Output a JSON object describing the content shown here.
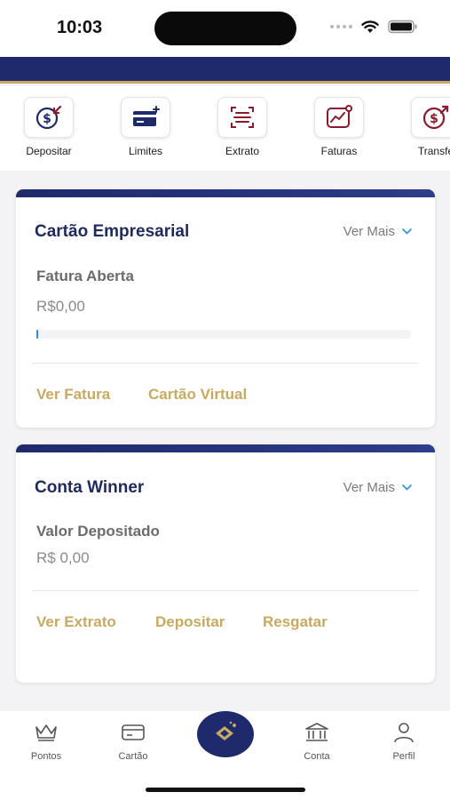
{
  "status_bar": {
    "time": "10:03"
  },
  "shortcuts": [
    {
      "label": "Depositar",
      "icon": "deposit-dollar-icon"
    },
    {
      "label": "Limites",
      "icon": "credit-card-icon"
    },
    {
      "label": "Extrato",
      "icon": "statement-scan-icon"
    },
    {
      "label": "Faturas",
      "icon": "invoice-chart-icon"
    },
    {
      "label": "Transfe",
      "icon": "transfer-dollar-icon"
    }
  ],
  "card_empresarial": {
    "title": "Cartão Empresarial",
    "ver_mais": "Ver Mais",
    "subtitle": "Fatura Aberta",
    "value": "R$0,00",
    "progress": 0,
    "link_fatura": "Ver Fatura",
    "link_virtual": "Cartão Virtual"
  },
  "card_winner": {
    "title": "Conta Winner",
    "ver_mais": "Ver Mais",
    "subtitle": "Valor Depositado",
    "value": "R$ 0,00",
    "link_extrato": "Ver Extrato",
    "link_depositar": "Depositar",
    "link_resgatar": "Resgatar"
  },
  "tabbar": {
    "items": [
      {
        "label": "Pontos",
        "icon": "crown-icon"
      },
      {
        "label": "Cartão",
        "icon": "card-icon"
      },
      {
        "label": "",
        "icon": "home-center-icon"
      },
      {
        "label": "Conta",
        "icon": "bank-icon"
      },
      {
        "label": "Perfil",
        "icon": "user-icon"
      }
    ]
  },
  "colors": {
    "navy": "#1e2a6b",
    "gold": "#c9a961",
    "icon_red": "#8b1a2b"
  }
}
